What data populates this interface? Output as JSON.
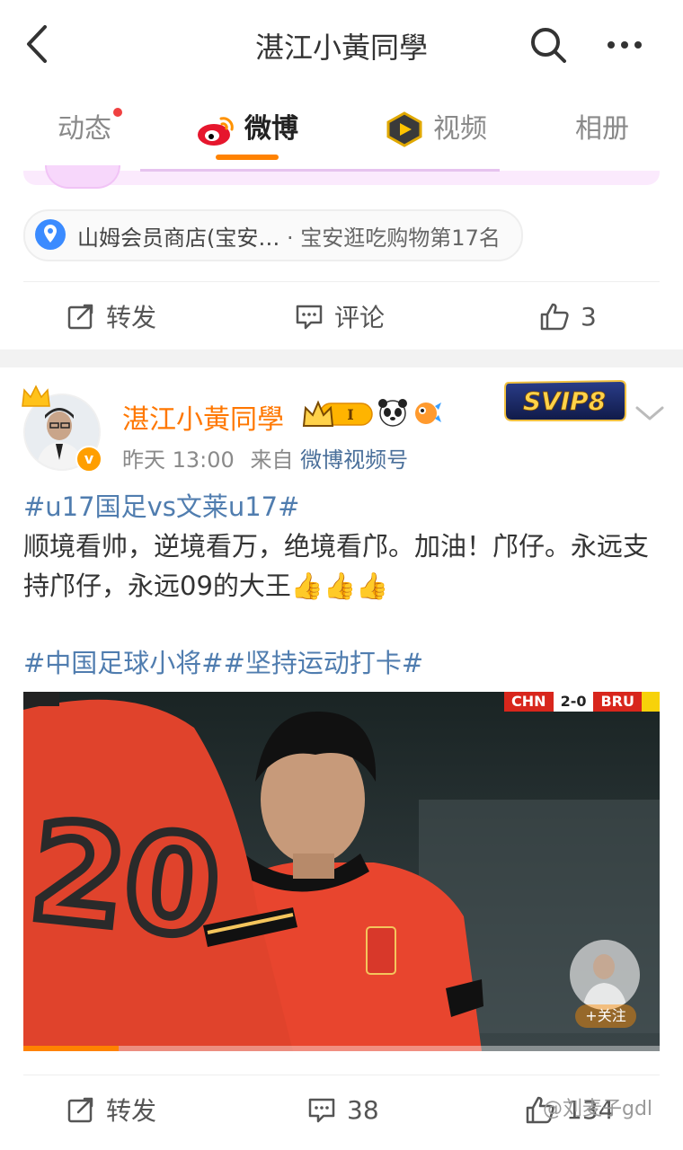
{
  "topbar": {
    "title": "湛江小黃同學"
  },
  "tabs": [
    {
      "label": "动态",
      "has_dot": true
    },
    {
      "label": "微博",
      "active": true
    },
    {
      "label": "视频"
    },
    {
      "label": "相册"
    }
  ],
  "prev_post": {
    "location_place": "山姆会员商店(宝安…",
    "location_sep": "·",
    "location_rank": "宝安逛吃购物第17名",
    "actions": {
      "repost_label": "转发",
      "comment_label": "评论",
      "like_count": "3"
    }
  },
  "post": {
    "username": "湛江小黃同學",
    "vip_badge": "SVIP8",
    "level_badge": "I",
    "time": "昨天 13:00",
    "source_prefix": "来自",
    "source": "微博视频号",
    "hashtag1": "#u17国足vs文莱u17#",
    "body": "顺境看帅，逆境看万，绝境看邝。加油！邝仔。永远支持邝仔，永远09的大王👍👍👍",
    "hashtags2": "#中国足球小将##坚持运动打卡#",
    "video": {
      "score_home": "CHN",
      "score": "2-0",
      "score_away": "BRU",
      "overlay_follow": "+关注",
      "progress": 0.15
    },
    "actions": {
      "repost_label": "转发",
      "comment_count": "38",
      "like_count": "134"
    }
  },
  "watermark": "@刘麦子gdl",
  "colors": {
    "accent_orange": "#ff8200",
    "username_orange": "#ff7700",
    "hashtag_blue": "#507daf",
    "notif_red": "#f04141"
  }
}
